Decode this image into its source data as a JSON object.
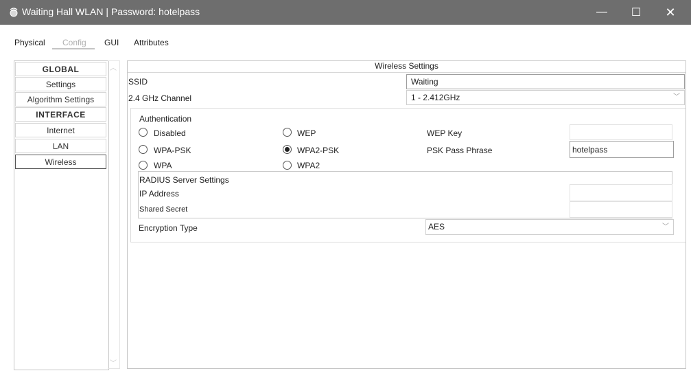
{
  "window": {
    "title": "Waiting Hall WLAN | Password: hotelpass",
    "minimize": "—",
    "maximize": "☐",
    "close": "✕"
  },
  "tabs": {
    "physical": "Physical",
    "config": "Config",
    "gui": "GUI",
    "attributes": "Attributes",
    "active": "Config"
  },
  "sidebar": {
    "items": [
      "GLOBAL",
      "Settings",
      "Algorithm Settings",
      "INTERFACE",
      "Internet",
      "LAN",
      "Wireless"
    ],
    "selected": "Wireless"
  },
  "wireless": {
    "header": "Wireless Settings",
    "ssid_label": "SSID",
    "ssid_value": "Waiting",
    "channel_label": "2.4 GHz Channel",
    "channel_value": "1 - 2.412GHz",
    "auth_label": "Authentication",
    "auth_options": {
      "disabled": "Disabled",
      "wep": "WEP",
      "wpa_psk": "WPA-PSK",
      "wpa2_psk": "WPA2-PSK",
      "wpa": "WPA",
      "wpa2": "WPA2"
    },
    "auth_selected": "WPA2-PSK",
    "wep_key_label": "WEP Key",
    "wep_key_value": "",
    "psk_label": "PSK Pass Phrase",
    "psk_value": "hotelpass",
    "radius_label": "RADIUS Server Settings",
    "ip_label": "IP Address",
    "ip_value": "",
    "secret_label": "Shared Secret",
    "secret_value": "",
    "encryption_label": "Encryption Type",
    "encryption_value": "AES"
  }
}
